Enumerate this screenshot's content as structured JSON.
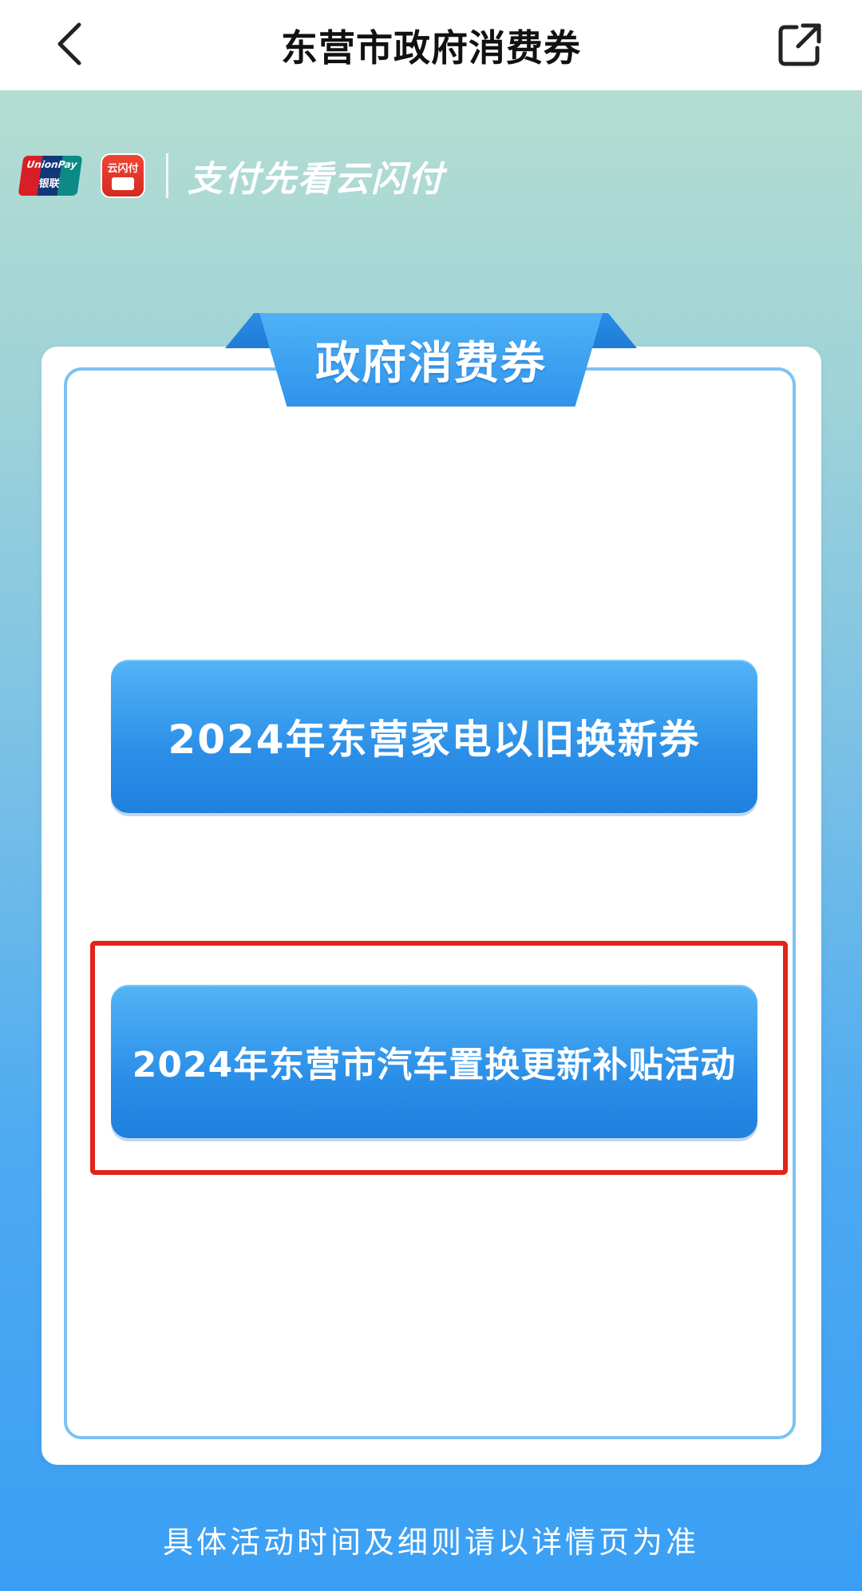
{
  "navbar": {
    "title": "东营市政府消费券",
    "back_icon": "chevron-left-icon",
    "share_icon": "share-external-icon"
  },
  "brand": {
    "unionpay_text": "UnionPay",
    "unionpay_cn": "银联",
    "ysf_text": "云闪付",
    "slogan": "支付先看云闪付"
  },
  "section": {
    "title": "政府消费券"
  },
  "vouchers": [
    {
      "label": "2024年东营家电以旧换新券"
    },
    {
      "label": "2024年东营市汽车置换更新补贴活动"
    }
  ],
  "footer": {
    "note": "具体活动时间及细则请以详情页为准"
  },
  "colors": {
    "accent_blue": "#2b8fe8",
    "highlight_red": "#e2231a"
  }
}
